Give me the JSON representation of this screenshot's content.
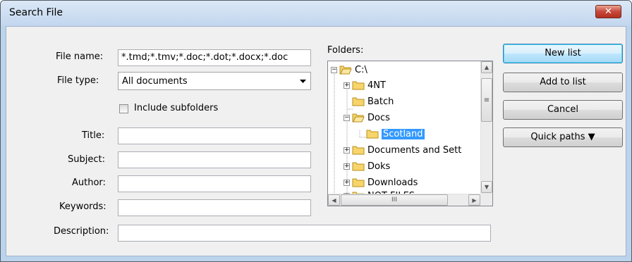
{
  "window": {
    "title": "Search File",
    "close_label": "✕"
  },
  "labels": {
    "file_name": "File name:",
    "file_type": "File type:",
    "include_subfolders": "Include subfolders",
    "title": "Title:",
    "subject": "Subject:",
    "author": "Author:",
    "keywords": "Keywords:",
    "description": "Description:",
    "folders": "Folders:"
  },
  "fields": {
    "file_name": "*.tmd;*.tmv;*.doc;*.dot;*.docx;*.doc",
    "file_type": "All documents",
    "title": "",
    "subject": "",
    "author": "",
    "keywords": "",
    "description": ""
  },
  "include_subfolders_checked": false,
  "tree": [
    {
      "label": "C:\\",
      "expander": "−",
      "open": true
    },
    {
      "label": "4NT",
      "expander": "+"
    },
    {
      "label": "Batch",
      "expander": ""
    },
    {
      "label": "Docs",
      "expander": "−",
      "open": true
    },
    {
      "label": "Scotland",
      "expander": "",
      "selected": true
    },
    {
      "label": "Documents and Sett",
      "expander": "+"
    },
    {
      "label": "Doks",
      "expander": "+"
    },
    {
      "label": "Downloads",
      "expander": "+"
    },
    {
      "label": "NOT FILES",
      "expander": "+"
    }
  ],
  "buttons": {
    "new_list": "New list",
    "add_to_list": "Add to list",
    "cancel": "Cancel",
    "quick_paths": "Quick paths ▼"
  },
  "scrollbar": {
    "h_grip": "III",
    "v_grip": "≡"
  },
  "colors": {
    "selection": "#3399ff",
    "folder": "#f7d56b",
    "titlebar": "#c8daf0"
  }
}
